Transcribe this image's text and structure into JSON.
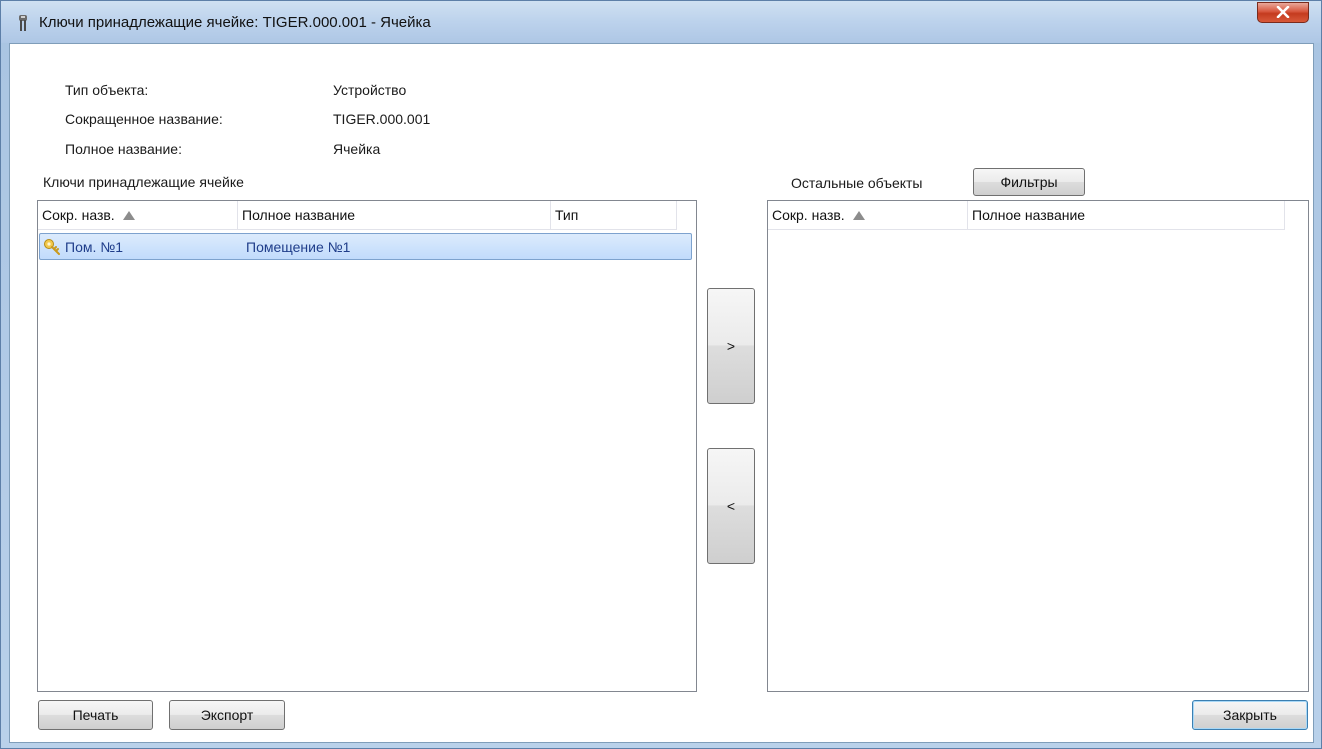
{
  "window": {
    "title": "Ключи принадлежащие ячейке: TIGER.000.001 - Ячейка",
    "close_glyph": "X"
  },
  "info": {
    "type_label": "Тип объекта:",
    "type_value": "Устройство",
    "short_label": "Сокращенное название:",
    "short_value": "TIGER.000.001",
    "full_label": "Полное название:",
    "full_value": "Ячейка"
  },
  "left_panel": {
    "title": "Ключи принадлежащие ячейке",
    "columns": [
      "Сокр. назв.",
      "Полное название",
      "Тип"
    ],
    "rows": [
      {
        "short": "Пом. №1",
        "full": "Помещение №1",
        "type": "",
        "selected": true,
        "icon": "key-icon"
      }
    ]
  },
  "right_panel": {
    "title": "Остальные объекты",
    "filters_label": "Фильтры",
    "columns": [
      "Сокр. назв.",
      "Полное название"
    ],
    "rows": []
  },
  "transfer": {
    "move_right_label": ">",
    "move_left_label": "<"
  },
  "footer": {
    "print_label": "Печать",
    "export_label": "Экспорт",
    "close_label": "Закрыть"
  },
  "colors": {
    "selection": "#c9dffb",
    "link_text": "#1f3d8a",
    "title_bar": "#bcd2ec"
  }
}
